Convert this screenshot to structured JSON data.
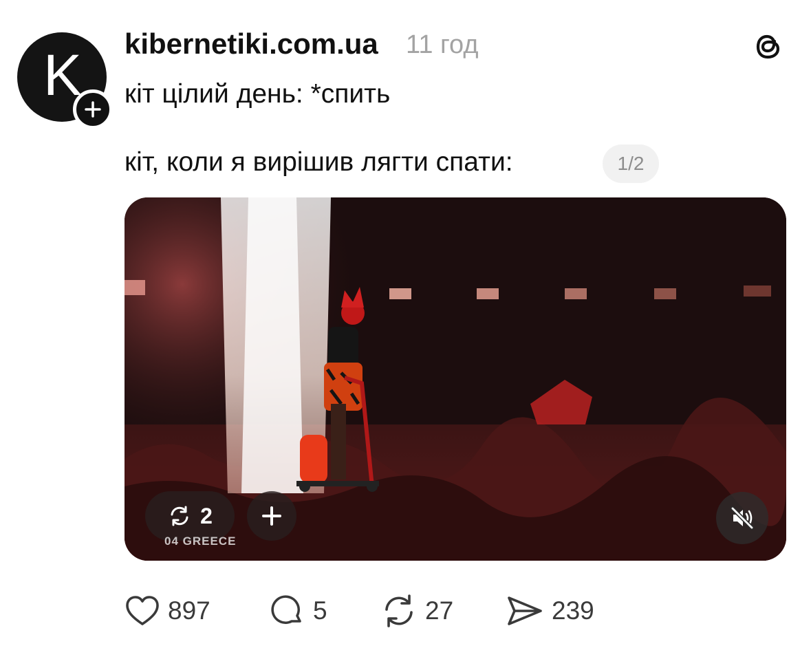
{
  "post": {
    "author": "kibernetiki.com.ua",
    "avatar_letter": "K",
    "time_ago": "11 год",
    "text_line1": "кіт цілий день: *спить",
    "text_line2": "кіт, коли я вирішив лягти спати:",
    "page_indicator": "1/2"
  },
  "media": {
    "repost_count": "2",
    "overlay_caption": "04 GREECE"
  },
  "actions": {
    "likes": "897",
    "comments": "5",
    "reposts": "27",
    "shares": "239"
  },
  "icons": [
    "plus-icon",
    "threads-logo-icon",
    "repost-icon",
    "mute-icon",
    "heart-icon",
    "comment-icon",
    "share-icon"
  ],
  "colors": {
    "text": "#111111",
    "muted": "#a3a3a3",
    "badge_bg": "#f1f1f1"
  }
}
